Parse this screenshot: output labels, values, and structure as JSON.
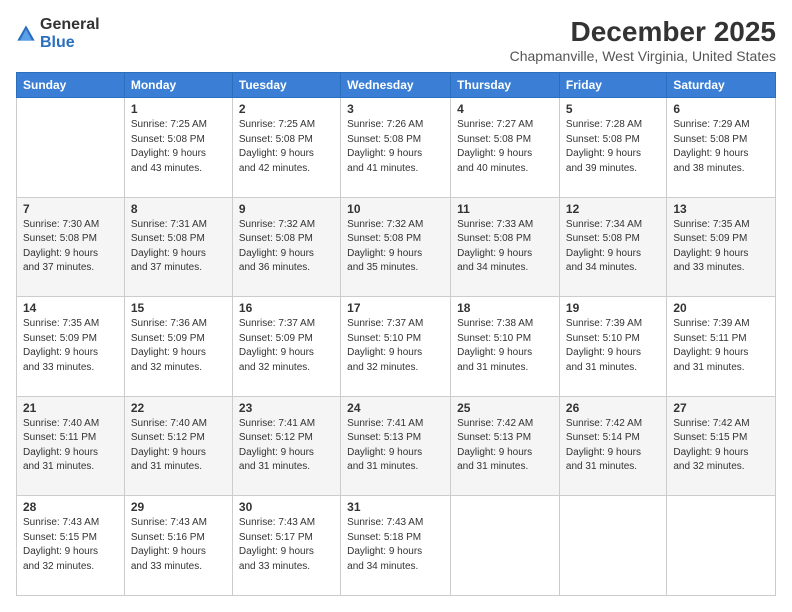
{
  "logo": {
    "general": "General",
    "blue": "Blue"
  },
  "header": {
    "month": "December 2025",
    "location": "Chapmanville, West Virginia, United States"
  },
  "weekdays": [
    "Sunday",
    "Monday",
    "Tuesday",
    "Wednesday",
    "Thursday",
    "Friday",
    "Saturday"
  ],
  "weeks": [
    [
      {
        "day": "",
        "info": ""
      },
      {
        "day": "1",
        "info": "Sunrise: 7:25 AM\nSunset: 5:08 PM\nDaylight: 9 hours\nand 43 minutes."
      },
      {
        "day": "2",
        "info": "Sunrise: 7:25 AM\nSunset: 5:08 PM\nDaylight: 9 hours\nand 42 minutes."
      },
      {
        "day": "3",
        "info": "Sunrise: 7:26 AM\nSunset: 5:08 PM\nDaylight: 9 hours\nand 41 minutes."
      },
      {
        "day": "4",
        "info": "Sunrise: 7:27 AM\nSunset: 5:08 PM\nDaylight: 9 hours\nand 40 minutes."
      },
      {
        "day": "5",
        "info": "Sunrise: 7:28 AM\nSunset: 5:08 PM\nDaylight: 9 hours\nand 39 minutes."
      },
      {
        "day": "6",
        "info": "Sunrise: 7:29 AM\nSunset: 5:08 PM\nDaylight: 9 hours\nand 38 minutes."
      }
    ],
    [
      {
        "day": "7",
        "info": "Sunrise: 7:30 AM\nSunset: 5:08 PM\nDaylight: 9 hours\nand 37 minutes."
      },
      {
        "day": "8",
        "info": "Sunrise: 7:31 AM\nSunset: 5:08 PM\nDaylight: 9 hours\nand 37 minutes."
      },
      {
        "day": "9",
        "info": "Sunrise: 7:32 AM\nSunset: 5:08 PM\nDaylight: 9 hours\nand 36 minutes."
      },
      {
        "day": "10",
        "info": "Sunrise: 7:32 AM\nSunset: 5:08 PM\nDaylight: 9 hours\nand 35 minutes."
      },
      {
        "day": "11",
        "info": "Sunrise: 7:33 AM\nSunset: 5:08 PM\nDaylight: 9 hours\nand 34 minutes."
      },
      {
        "day": "12",
        "info": "Sunrise: 7:34 AM\nSunset: 5:08 PM\nDaylight: 9 hours\nand 34 minutes."
      },
      {
        "day": "13",
        "info": "Sunrise: 7:35 AM\nSunset: 5:09 PM\nDaylight: 9 hours\nand 33 minutes."
      }
    ],
    [
      {
        "day": "14",
        "info": "Sunrise: 7:35 AM\nSunset: 5:09 PM\nDaylight: 9 hours\nand 33 minutes."
      },
      {
        "day": "15",
        "info": "Sunrise: 7:36 AM\nSunset: 5:09 PM\nDaylight: 9 hours\nand 32 minutes."
      },
      {
        "day": "16",
        "info": "Sunrise: 7:37 AM\nSunset: 5:09 PM\nDaylight: 9 hours\nand 32 minutes."
      },
      {
        "day": "17",
        "info": "Sunrise: 7:37 AM\nSunset: 5:10 PM\nDaylight: 9 hours\nand 32 minutes."
      },
      {
        "day": "18",
        "info": "Sunrise: 7:38 AM\nSunset: 5:10 PM\nDaylight: 9 hours\nand 31 minutes."
      },
      {
        "day": "19",
        "info": "Sunrise: 7:39 AM\nSunset: 5:10 PM\nDaylight: 9 hours\nand 31 minutes."
      },
      {
        "day": "20",
        "info": "Sunrise: 7:39 AM\nSunset: 5:11 PM\nDaylight: 9 hours\nand 31 minutes."
      }
    ],
    [
      {
        "day": "21",
        "info": "Sunrise: 7:40 AM\nSunset: 5:11 PM\nDaylight: 9 hours\nand 31 minutes."
      },
      {
        "day": "22",
        "info": "Sunrise: 7:40 AM\nSunset: 5:12 PM\nDaylight: 9 hours\nand 31 minutes."
      },
      {
        "day": "23",
        "info": "Sunrise: 7:41 AM\nSunset: 5:12 PM\nDaylight: 9 hours\nand 31 minutes."
      },
      {
        "day": "24",
        "info": "Sunrise: 7:41 AM\nSunset: 5:13 PM\nDaylight: 9 hours\nand 31 minutes."
      },
      {
        "day": "25",
        "info": "Sunrise: 7:42 AM\nSunset: 5:13 PM\nDaylight: 9 hours\nand 31 minutes."
      },
      {
        "day": "26",
        "info": "Sunrise: 7:42 AM\nSunset: 5:14 PM\nDaylight: 9 hours\nand 31 minutes."
      },
      {
        "day": "27",
        "info": "Sunrise: 7:42 AM\nSunset: 5:15 PM\nDaylight: 9 hours\nand 32 minutes."
      }
    ],
    [
      {
        "day": "28",
        "info": "Sunrise: 7:43 AM\nSunset: 5:15 PM\nDaylight: 9 hours\nand 32 minutes."
      },
      {
        "day": "29",
        "info": "Sunrise: 7:43 AM\nSunset: 5:16 PM\nDaylight: 9 hours\nand 33 minutes."
      },
      {
        "day": "30",
        "info": "Sunrise: 7:43 AM\nSunset: 5:17 PM\nDaylight: 9 hours\nand 33 minutes."
      },
      {
        "day": "31",
        "info": "Sunrise: 7:43 AM\nSunset: 5:18 PM\nDaylight: 9 hours\nand 34 minutes."
      },
      {
        "day": "",
        "info": ""
      },
      {
        "day": "",
        "info": ""
      },
      {
        "day": "",
        "info": ""
      }
    ]
  ]
}
